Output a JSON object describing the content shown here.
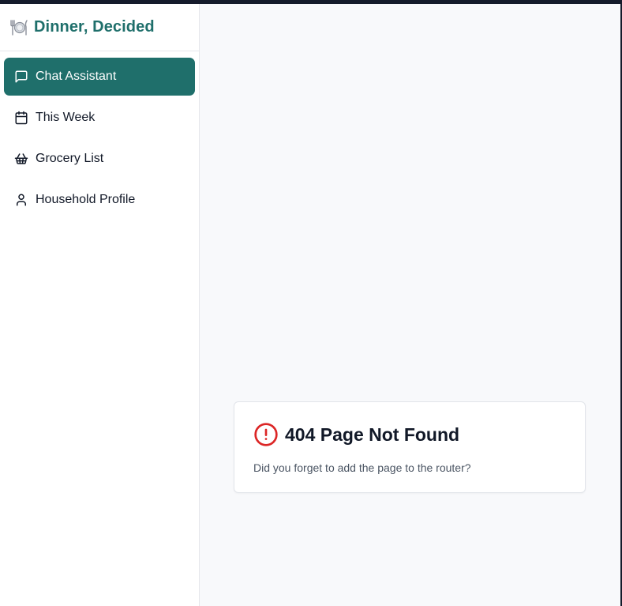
{
  "app": {
    "title": "Dinner, Decided",
    "logo_icon": "plate-cutlery-icon",
    "accent_color": "#1f6f6b"
  },
  "sidebar": {
    "items": [
      {
        "label": "Chat Assistant",
        "icon": "message-square-icon",
        "active": true
      },
      {
        "label": "This Week",
        "icon": "calendar-icon",
        "active": false
      },
      {
        "label": "Grocery List",
        "icon": "shopping-basket-icon",
        "active": false
      },
      {
        "label": "Household Profile",
        "icon": "user-icon",
        "active": false
      }
    ]
  },
  "error": {
    "title": "404 Page Not Found",
    "message": "Did you forget to add the page to the router?",
    "icon": "alert-circle-icon",
    "icon_color": "#dc2626"
  }
}
